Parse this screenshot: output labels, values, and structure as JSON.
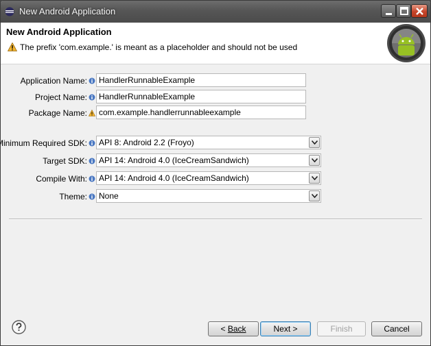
{
  "window": {
    "title": "New Android Application"
  },
  "header": {
    "title": "New Android Application",
    "message": "The prefix 'com.example.' is meant as a placeholder and should not be used"
  },
  "form": {
    "application_name": {
      "label": "Application Name:",
      "value": "HandlerRunnableExample"
    },
    "project_name": {
      "label": "Project Name:",
      "value": "HandlerRunnableExample"
    },
    "package_name": {
      "label": "Package Name:",
      "value": "com.example.handlerrunnableexample"
    },
    "min_sdk": {
      "label": "Minimum Required SDK:",
      "value": "API 8: Android 2.2 (Froyo)"
    },
    "target_sdk": {
      "label": "Target SDK:",
      "value": "API 14: Android 4.0 (IceCreamSandwich)"
    },
    "compile_with": {
      "label": "Compile With:",
      "value": "API 14: Android 4.0 (IceCreamSandwich)"
    },
    "theme": {
      "label": "Theme:",
      "value": "None"
    }
  },
  "buttons": {
    "back": "Back",
    "back_prefix": "< ",
    "next": "Next >",
    "finish": "Finish",
    "cancel": "Cancel"
  },
  "colors": {
    "accent": "#3c7fb1",
    "close_button": "#c6452a",
    "android_green": "#97c024"
  }
}
